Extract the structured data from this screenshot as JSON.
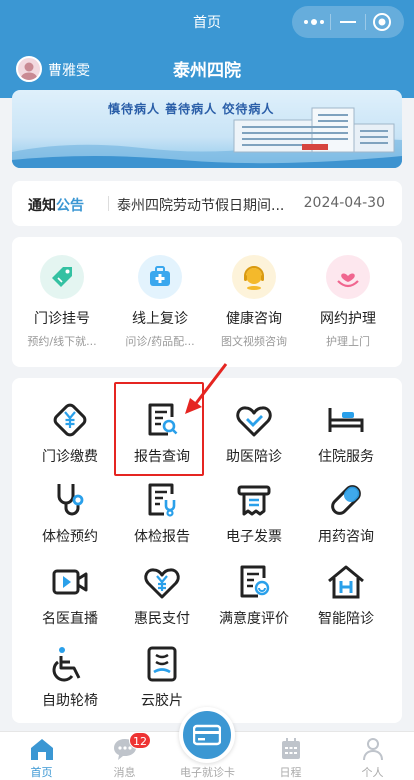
{
  "topbar": {
    "title": "首页"
  },
  "header": {
    "user_name": "曹雅雯",
    "hospital": "泰州四院"
  },
  "banner": {
    "slogan": "慎待病人 善待病人 佼待病人"
  },
  "notice": {
    "tag_a": "通知",
    "tag_b": "公告",
    "text": "泰州四院劳动节假日期间...",
    "date": "2024-04-30"
  },
  "quick": [
    {
      "label": "门诊挂号",
      "sub": "预约/线下就...",
      "icon": "tag-icon",
      "bg": "#e4f5f1",
      "color": "#34c1a2"
    },
    {
      "label": "线上复诊",
      "sub": "问诊/药品配...",
      "icon": "medkit-icon",
      "bg": "#e3f3fd",
      "color": "#3aa7ee"
    },
    {
      "label": "健康咨询",
      "sub": "图文视频咨询",
      "icon": "consult-icon",
      "bg": "#fdf3da",
      "color": "#f4b92b"
    },
    {
      "label": "网约护理",
      "sub": "护理上门",
      "icon": "care-icon",
      "bg": "#fde7ee",
      "color": "#f0668f"
    }
  ],
  "grid": [
    {
      "label": "门诊缴费",
      "icon": "yen-diamond-icon"
    },
    {
      "label": "报告查询",
      "icon": "report-search-icon"
    },
    {
      "label": "助医陪诊",
      "icon": "handshake-heart-icon"
    },
    {
      "label": "住院服务",
      "icon": "bed-icon"
    },
    {
      "label": "体检预约",
      "icon": "stethoscope-icon"
    },
    {
      "label": "体检报告",
      "icon": "report-stethoscope-icon"
    },
    {
      "label": "电子发票",
      "icon": "invoice-icon"
    },
    {
      "label": "用药咨询",
      "icon": "pill-icon"
    },
    {
      "label": "名医直播",
      "icon": "video-camera-icon"
    },
    {
      "label": "惠民支付",
      "icon": "heart-yen-icon"
    },
    {
      "label": "满意度评价",
      "icon": "review-icon"
    },
    {
      "label": "智能陪诊",
      "icon": "smart-house-icon"
    },
    {
      "label": "自助轮椅",
      "icon": "wheelchair-icon"
    },
    {
      "label": "云胶片",
      "icon": "film-icon"
    }
  ],
  "tabbar": [
    {
      "label": "首页",
      "icon": "home-icon",
      "active": true
    },
    {
      "label": "消息",
      "icon": "chat-icon",
      "badge": "12"
    },
    {
      "label": "电子就诊卡",
      "icon": "card-icon"
    },
    {
      "label": "日程",
      "icon": "calendar-icon"
    },
    {
      "label": "个人",
      "icon": "person-icon"
    }
  ],
  "colors": {
    "brand": "#3b97d3",
    "highlight": "#e52521",
    "badge": "#e33333"
  }
}
